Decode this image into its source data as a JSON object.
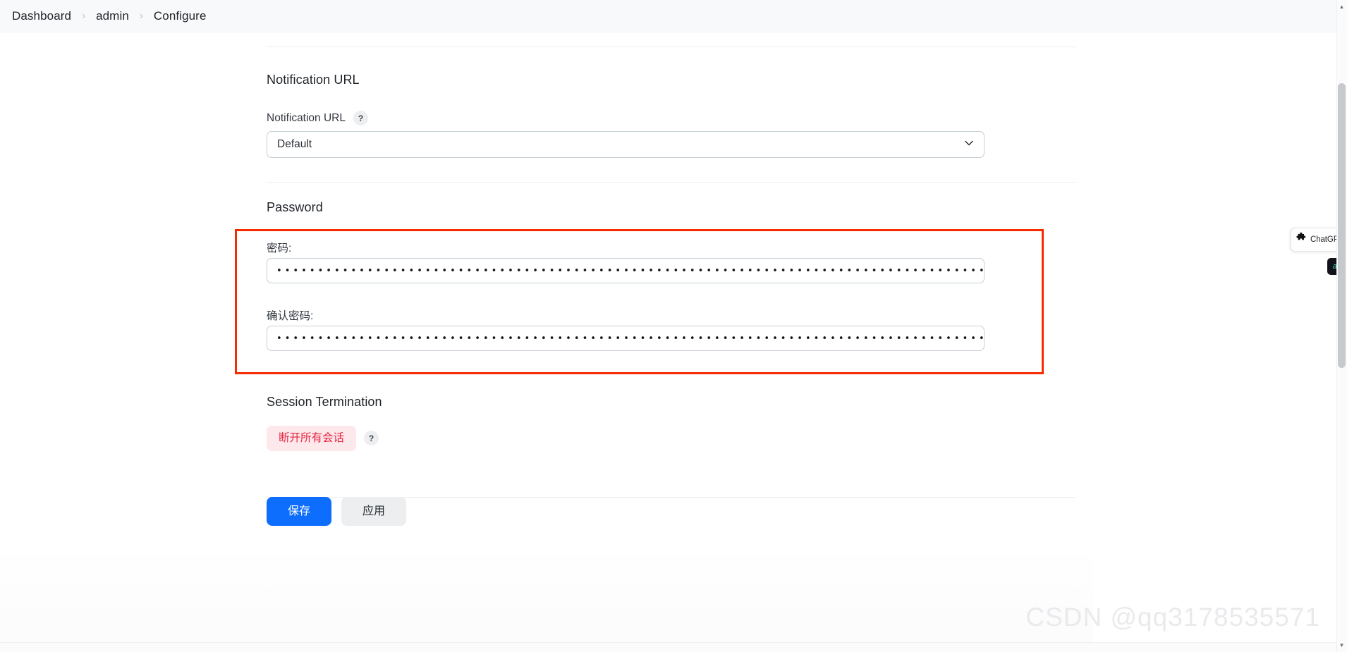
{
  "breadcrumb": {
    "items": [
      {
        "label": "Dashboard"
      },
      {
        "label": "admin"
      },
      {
        "label": "Configure"
      }
    ],
    "separator": "›"
  },
  "sections": {
    "notification": {
      "title": "Notification URL",
      "field_label": "Notification URL",
      "help": "?",
      "select_value": "Default",
      "chevron": "chevron-down-icon"
    },
    "password": {
      "title": "Password",
      "password_label": "密码:",
      "password_value": "•••••••••••••••••••••••••••••••••••••••••••••••••••••••••••••••••••••••••••••••••••••••••••••••••••••••••••••••••••••••••••••••••••••••••••••••••••••••••••••••••••••••••••••••••••••••••••••••••••••••••••••••••••",
      "confirm_label": "确认密码:",
      "confirm_value": "•••••••••••••••••••••••••••••••••••••••••••••••••••••••••••••••••••••••••••••••••••••••••••••••••••••••••••••••••••••••••••••••••••••••••••••••••••••••••••••••••••••••••••••••••••••••••••••••••••••••••••••••••••"
    },
    "session": {
      "title": "Session Termination",
      "disconnect_label": "断开所有会话",
      "help": "?"
    }
  },
  "footer": {
    "save_label": "保存",
    "apply_label": "应用"
  },
  "widgets": {
    "chatgpt_label": "ChatGPT",
    "ai_label": "ai"
  },
  "watermark": "CSDN @qq3178535571",
  "colors": {
    "accent": "#0d6efd",
    "danger_text": "#e8243f",
    "danger_bg": "#fde8ec",
    "annotation": "#f52d00",
    "breadcrumb_bg": "#f8f9fa"
  }
}
